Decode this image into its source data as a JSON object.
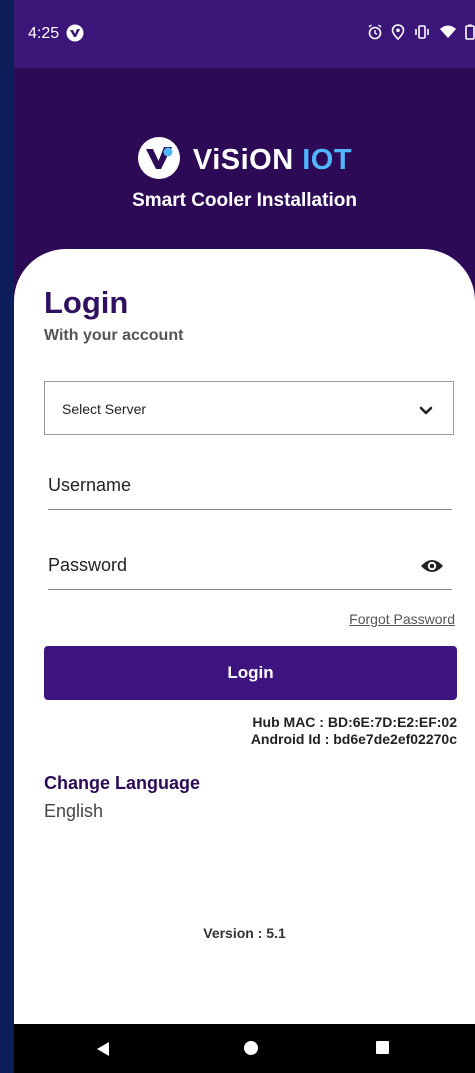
{
  "status_bar": {
    "time": "4:25",
    "icons": [
      "vision-app-icon",
      "alarm-icon",
      "location-icon",
      "vibrate-icon",
      "wifi-icon",
      "battery-icon"
    ]
  },
  "header": {
    "brand_primary": "ViSiON",
    "brand_accent": "IOT",
    "subtitle": "Smart Cooler Installation"
  },
  "form": {
    "title": "Login",
    "subtitle": "With your account",
    "server_select_label": "Select Server",
    "username_placeholder": "Username",
    "password_placeholder": "Password",
    "forgot_password": "Forgot Password",
    "login_button": "Login"
  },
  "device_info": {
    "hub_mac": "Hub MAC : BD:6E:7D:E2:EF:02",
    "android_id": "Android Id : bd6e7de2ef02270c"
  },
  "language": {
    "label": "Change Language",
    "value": "English"
  },
  "version": "Version : 5.1",
  "colors": {
    "header_bg": "#2c0a55",
    "status_bar_bg": "#3b1578",
    "primary_button": "#3d1480",
    "brand_accent": "#4fb6ff",
    "frame_border": "#0c1e5a"
  },
  "nav_bar": {
    "icons": [
      "back-icon",
      "home-icon",
      "recents-icon"
    ]
  }
}
